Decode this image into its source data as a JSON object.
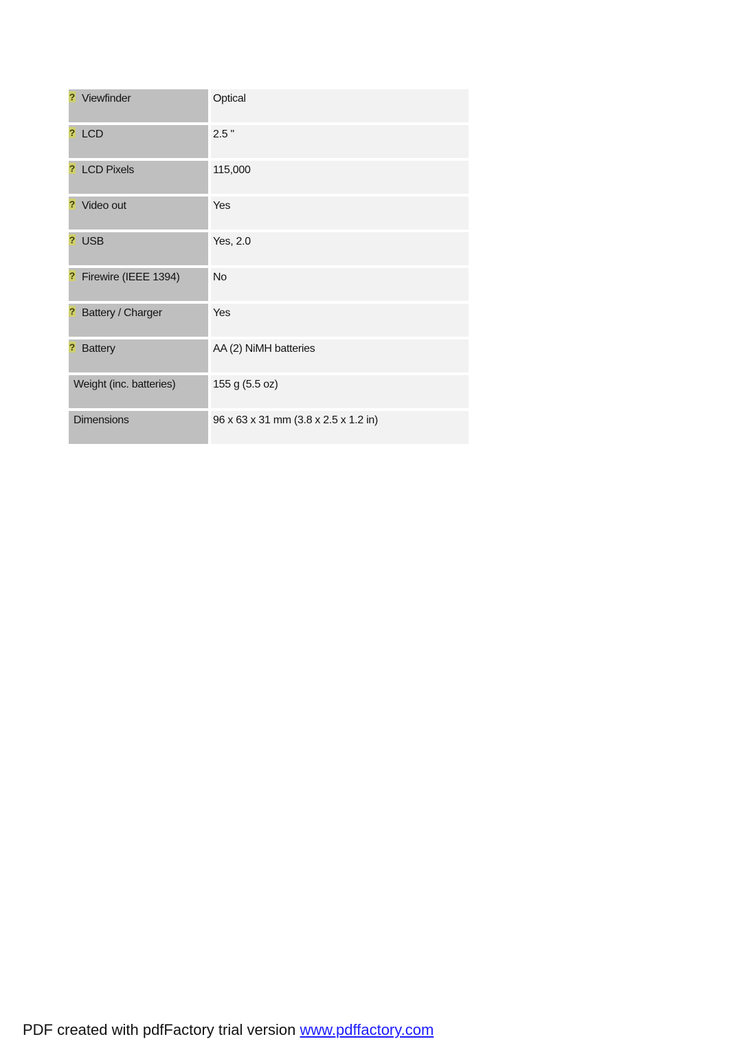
{
  "specs": [
    {
      "label": "Viewfinder",
      "value": "Optical",
      "help_icon": true
    },
    {
      "label": "LCD",
      "value": "2.5 \"",
      "help_icon": true
    },
    {
      "label": "LCD Pixels",
      "value": "115,000",
      "help_icon": true
    },
    {
      "label": "Video out",
      "value": "Yes",
      "help_icon": true
    },
    {
      "label": "USB",
      "value": "Yes, 2.0",
      "help_icon": true
    },
    {
      "label": "Firewire (IEEE 1394)",
      "value": "No",
      "help_icon": true
    },
    {
      "label": "Battery / Charger",
      "value": "Yes",
      "help_icon": true
    },
    {
      "label": "Battery",
      "value": "AA (2) NiMH batteries",
      "help_icon": true
    },
    {
      "label": "Weight (inc. batteries)",
      "value": "155 g (5.5 oz)",
      "help_icon": false
    },
    {
      "label": "Dimensions",
      "value": "96 x 63 x 31 mm (3.8 x 2.5 x 1.2 in)",
      "help_icon": false
    }
  ],
  "help_icon_glyph": "?",
  "footer": {
    "text": "PDF created with pdfFactory trial version ",
    "link_text": "www.pdffactory.com "
  }
}
